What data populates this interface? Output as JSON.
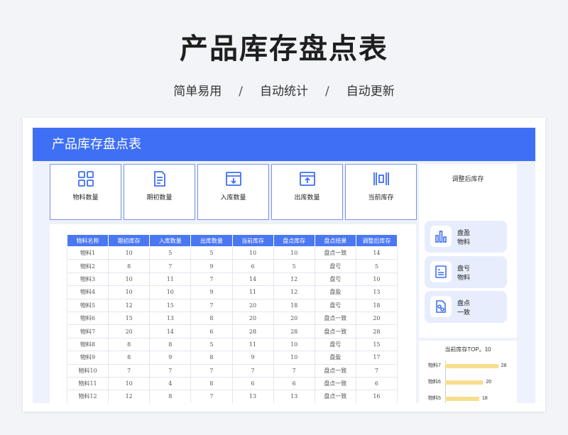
{
  "hero": {
    "title": "产品库存盘点表",
    "tags": [
      "简单易用",
      "自动统计",
      "自动更新"
    ],
    "separator": "/"
  },
  "sheet": {
    "header": "产品库存盘点表",
    "accent": "#3f6ff4",
    "kpis": [
      {
        "label": "物料数量",
        "icon": "grid-icon"
      },
      {
        "label": "期初数量",
        "icon": "document-icon"
      },
      {
        "label": "入库数量",
        "icon": "box-in-icon"
      },
      {
        "label": "出库数量",
        "icon": "box-out-icon"
      },
      {
        "label": "当前库存",
        "icon": "barcode-icon"
      }
    ],
    "adjusted_label": "调整后库存",
    "stats": [
      {
        "line1": "盘盈",
        "line2": "物料",
        "icon": "bar-chart-icon"
      },
      {
        "line1": "盘亏",
        "line2": "物料",
        "icon": "report-icon"
      },
      {
        "line1": "盘点",
        "line2": "一致",
        "icon": "check-doc-icon"
      }
    ]
  },
  "table": {
    "headers": [
      "物料名称",
      "期初库存",
      "入库数量",
      "出库数量",
      "当前库存",
      "盘点库存",
      "盘点结果",
      "调整后库存"
    ],
    "rows": [
      [
        "物料1",
        "10",
        "5",
        "5",
        "10",
        "10",
        "盘点一致",
        "14"
      ],
      [
        "物料2",
        "8",
        "7",
        "9",
        "6",
        "5",
        "盘亏",
        "5"
      ],
      [
        "物料3",
        "10",
        "11",
        "7",
        "14",
        "12",
        "盘亏",
        "10"
      ],
      [
        "物料4",
        "10",
        "10",
        "9",
        "11",
        "12",
        "盘盈",
        "13"
      ],
      [
        "物料5",
        "12",
        "15",
        "7",
        "20",
        "18",
        "盘亏",
        "18"
      ],
      [
        "物料6",
        "15",
        "13",
        "8",
        "20",
        "20",
        "盘点一致",
        "20"
      ],
      [
        "物料7",
        "20",
        "14",
        "6",
        "28",
        "28",
        "盘点一致",
        "28"
      ],
      [
        "物料8",
        "8",
        "8",
        "5",
        "11",
        "10",
        "盘亏",
        "15"
      ],
      [
        "物料9",
        "8",
        "9",
        "8",
        "9",
        "10",
        "盘盈",
        "17"
      ],
      [
        "物料10",
        "7",
        "7",
        "7",
        "7",
        "7",
        "盘点一致",
        "7"
      ],
      [
        "物料11",
        "10",
        "4",
        "8",
        "6",
        "6",
        "盘点一致",
        "6"
      ],
      [
        "物料12",
        "12",
        "8",
        "7",
        "13",
        "13",
        "盘点一致",
        "16"
      ]
    ]
  },
  "chart_data": {
    "type": "bar",
    "title": "当前库存TOP。10",
    "categories": [
      "物料7",
      "物料6",
      "物料5"
    ],
    "values": [
      28,
      20,
      18
    ],
    "xlim": [
      0,
      30
    ],
    "bar_color": "#f9dd8e"
  }
}
